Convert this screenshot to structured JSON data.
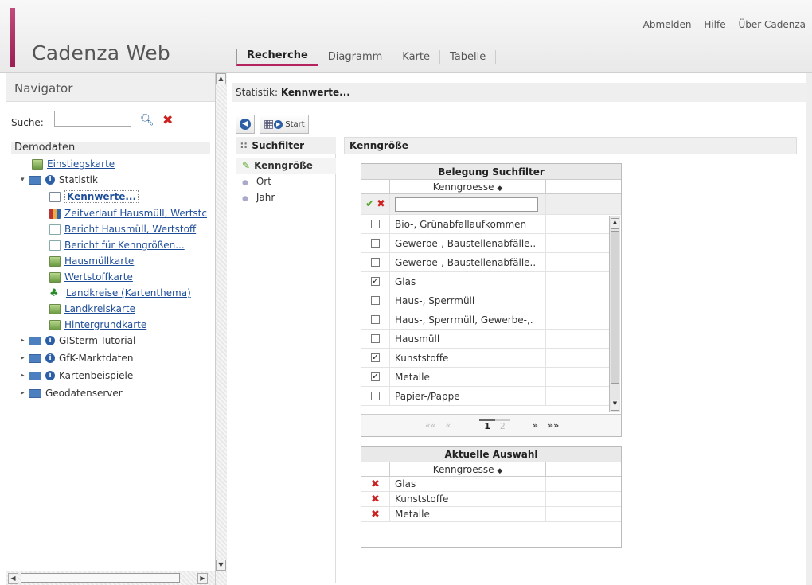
{
  "app": {
    "title": "Cadenza Web",
    "brand_color": "#b4235e",
    "top_links": [
      "Abmelden",
      "Hilfe",
      "Über Cadenza"
    ],
    "tabs": [
      {
        "label": "Recherche",
        "active": true
      },
      {
        "label": "Diagramm",
        "active": false
      },
      {
        "label": "Karte",
        "active": false
      },
      {
        "label": "Tabelle",
        "active": false
      }
    ]
  },
  "navigator": {
    "title": "Navigator",
    "search_label": "Suche:",
    "search_value": "",
    "root": "Demodaten",
    "items": [
      {
        "label": "Einstiegskarte",
        "icon": "map-icon",
        "link": true
      },
      {
        "label": "Statistik",
        "icon": "info-icon",
        "link": false
      },
      {
        "label": "Kennwerte...",
        "icon": "magnifier-table-icon",
        "link": true,
        "selected": true
      },
      {
        "label": "Zeitverlauf Hausmüll, Wertstc",
        "icon": "chart-icon",
        "link": true
      },
      {
        "label": "Bericht Hausmüll, Wertstoff",
        "icon": "report-icon",
        "link": true
      },
      {
        "label": "Bericht für Kenngrößen...",
        "icon": "report-icon",
        "link": true
      },
      {
        "label": "Hausmüllkarte",
        "icon": "map-icon",
        "link": true
      },
      {
        "label": "Wertstoffkarte",
        "icon": "map-icon",
        "link": true
      },
      {
        "label": "Landkreise (Kartenthema)",
        "icon": "leaf-icon",
        "link": true
      },
      {
        "label": "Landkreiskarte",
        "icon": "map-icon",
        "link": true
      },
      {
        "label": "Hintergrundkarte",
        "icon": "map-icon",
        "link": true
      },
      {
        "label": "GISterm-Tutorial",
        "icon": "info-icon",
        "link": false
      },
      {
        "label": "GfK-Marktdaten",
        "icon": "info-icon",
        "link": false
      },
      {
        "label": "Kartenbeispiele",
        "icon": "info-icon",
        "link": false
      },
      {
        "label": "Geodatenserver",
        "icon": "folder-icon",
        "link": false
      }
    ]
  },
  "main": {
    "status_prefix": "Statistik:",
    "status_value": "Kennwerte...",
    "start_label": "Start",
    "filter_title": "Suchfilter",
    "filters": [
      {
        "label": "Kenngröße",
        "active": true
      },
      {
        "label": "Ort",
        "active": false
      },
      {
        "label": "Jahr",
        "active": false
      }
    ],
    "section_title": "Kenngröße",
    "belegung": {
      "title": "Belegung Suchfilter",
      "column": "Kenngroesse",
      "filter_value": "",
      "rows": [
        {
          "label": "Bio-, Grünabfallaufkommen",
          "checked": false
        },
        {
          "label": "Gewerbe-, Baustellenabfälle..",
          "checked": false
        },
        {
          "label": "Gewerbe-, Baustellenabfälle..",
          "checked": false
        },
        {
          "label": "Glas",
          "checked": true
        },
        {
          "label": "Haus-, Sperrmüll",
          "checked": false
        },
        {
          "label": "Haus-, Sperrmüll, Gewerbe-,.",
          "checked": false
        },
        {
          "label": "Hausmüll",
          "checked": false
        },
        {
          "label": "Kunststoffe",
          "checked": true
        },
        {
          "label": "Metalle",
          "checked": true
        },
        {
          "label": "Papier-/Pappe",
          "checked": false
        }
      ],
      "pager": {
        "first": "««",
        "prev": "«",
        "current": "1",
        "next_page": "2",
        "next": "»",
        "last": "»»"
      }
    },
    "auswahl": {
      "title": "Aktuelle Auswahl",
      "column": "Kenngroesse",
      "rows": [
        "Glas",
        "Kunststoffe",
        "Metalle"
      ]
    }
  }
}
